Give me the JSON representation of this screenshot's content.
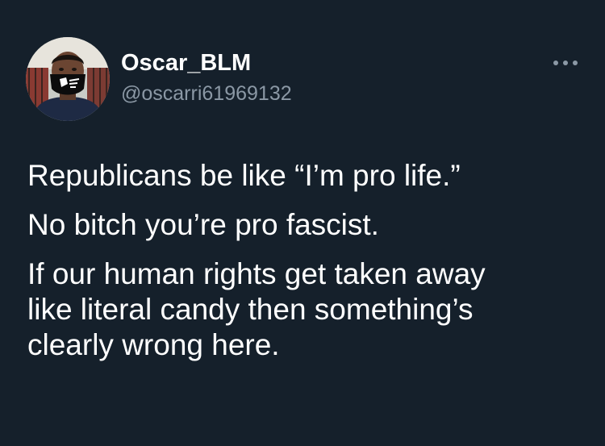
{
  "tweet": {
    "author": {
      "display_name": "Oscar_BLM",
      "handle": "@oscarri61969132",
      "mask_text": "BLACK LIVES MATTER"
    },
    "more_icon": "more-horizontal-icon",
    "paragraphs": [
      "Republicans be like “I’m pro life.”",
      "No bitch you’re pro fascist.",
      "If our human rights get taken away\nlike literal candy then something’s\nclearly wrong here."
    ]
  },
  "colors": {
    "background": "#15202b",
    "text_primary": "#ffffff",
    "text_secondary": "#8b98a5"
  }
}
